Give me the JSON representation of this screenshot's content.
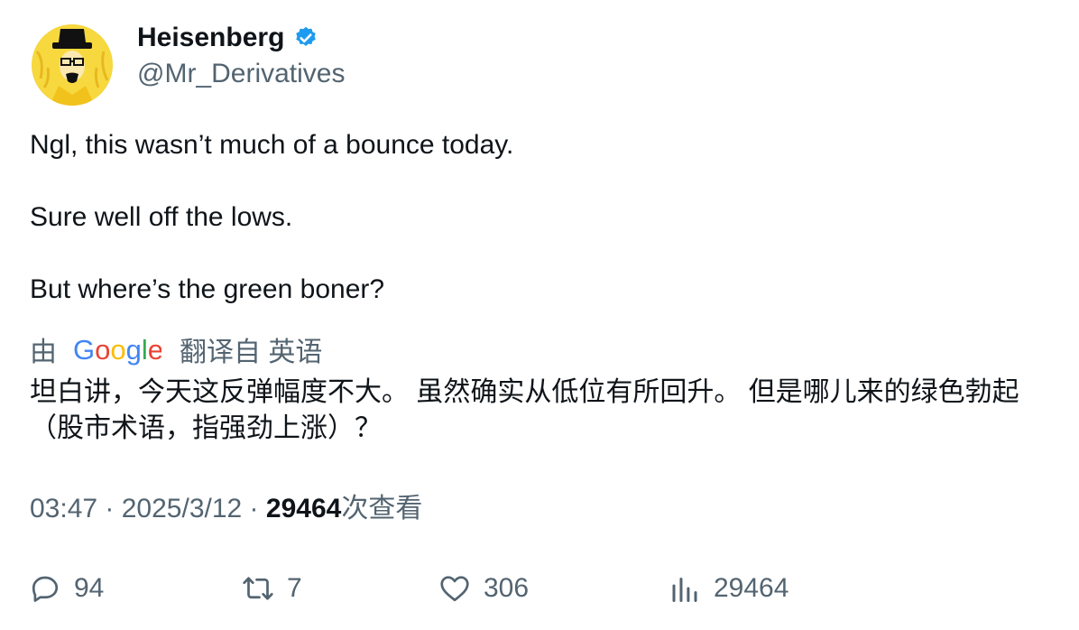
{
  "user": {
    "display_name": "Heisenberg",
    "handle": "@Mr_Derivatives",
    "verified": true,
    "verified_color": "#1d9bf0",
    "avatar_icon": "heisenberg-avatar-icon",
    "avatar_bg": "#f5d53b"
  },
  "tweet": {
    "lines": [
      "Ngl, this wasn’t much of a bounce today.",
      "Sure well off the lows.",
      "But where’s the green boner?"
    ]
  },
  "translation": {
    "prefix": "由",
    "provider_logo": "google-logo",
    "suffix": "翻译自 英语",
    "text": "坦白讲，今天这反弹幅度不大。 虽然确实从低位有所回升。 但是哪儿来的绿色勃起（股市术语，指强劲上涨）？"
  },
  "meta": {
    "time": "03:47",
    "sep1": " · ",
    "date": "2025/3/12",
    "sep2": " · ",
    "views_count": "29464",
    "views_label": "次查看"
  },
  "actions": {
    "reply_count": "94",
    "retweet_count": "7",
    "like_count": "306",
    "views_count": "29464"
  }
}
